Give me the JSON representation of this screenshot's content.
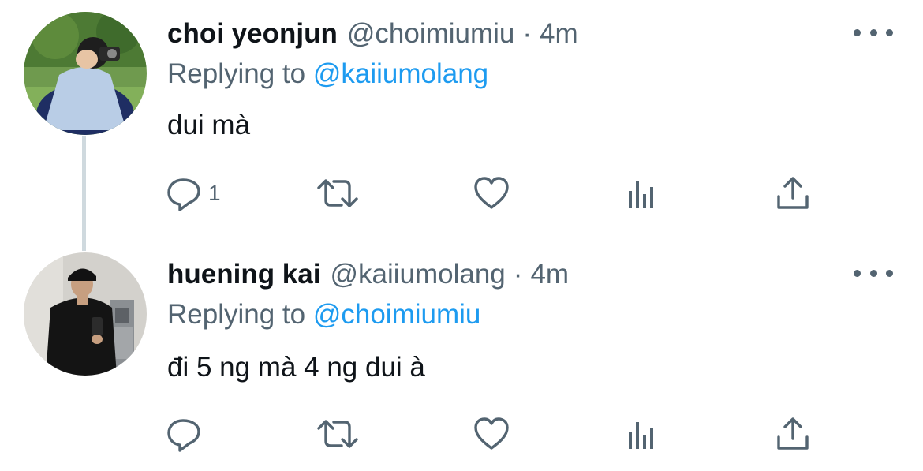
{
  "colors": {
    "text_primary": "#0f1419",
    "text_secondary": "#536471",
    "link": "#1d9bf0",
    "thread_line": "#cfd9de"
  },
  "tweets": [
    {
      "display_name": "choi yeonjun",
      "handle": "@choimiumiu",
      "separator": "·",
      "time": "4m",
      "reply_prefix": "Replying to",
      "reply_mention": "@kaiiumolang",
      "text": "dui mà",
      "reply_count": "1",
      "icons": [
        "reply-icon",
        "retweet-icon",
        "like-icon",
        "analytics-icon",
        "share-icon",
        "more-icon"
      ]
    },
    {
      "display_name": "huening kai",
      "handle": "@kaiiumolang",
      "separator": "·",
      "time": "4m",
      "reply_prefix": "Replying to",
      "reply_mention": "@choimiumiu",
      "text": "đi 5 ng mà 4 ng dui à",
      "reply_count": "",
      "icons": [
        "reply-icon",
        "retweet-icon",
        "like-icon",
        "analytics-icon",
        "share-icon",
        "more-icon"
      ]
    }
  ]
}
